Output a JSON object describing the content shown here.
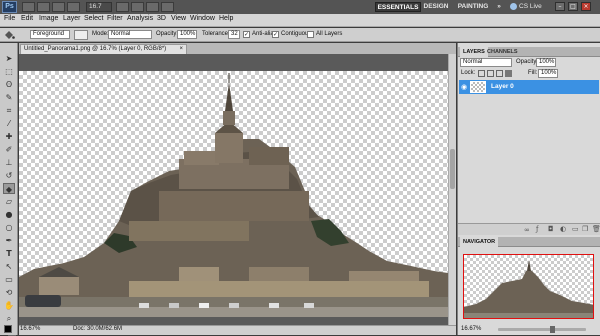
{
  "app": {
    "logo": "Ps",
    "zoom": "16.7"
  },
  "workspaces": {
    "essentials": "ESSENTIALS",
    "design": "DESIGN",
    "painting": "PAINTING",
    "more": "»",
    "cslive": "CS Live"
  },
  "menu": [
    "File",
    "Edit",
    "Image",
    "Layer",
    "Select",
    "Filter",
    "Analysis",
    "3D",
    "View",
    "Window",
    "Help"
  ],
  "options": {
    "fill_source": "Foreground",
    "mode_label": "Mode:",
    "mode_value": "Normal",
    "opacity_label": "Opacity:",
    "opacity_value": "100%",
    "tolerance_label": "Tolerance:",
    "tolerance_value": "32",
    "antialias_label": "Anti-alias",
    "contiguous_label": "Contiguous",
    "all_layers_label": "All Layers"
  },
  "document": {
    "tab_title": "Untitled_Panorama1.png @ 16.7% (Layer 0, RGB/8*)",
    "close_glyph": "×",
    "status_zoom": "16.67%",
    "status_doc": "Doc: 30.0M/62.6M"
  },
  "layers_panel": {
    "tab_layers": "LAYERS",
    "tab_channels": "CHANNELS",
    "blend_mode": "Normal",
    "opacity_label": "Opacity:",
    "opacity_value": "100%",
    "lock_label": "Lock:",
    "fill_label": "Fill:",
    "fill_value": "100%",
    "layer_name": "Layer 0"
  },
  "navigator_panel": {
    "tab": "NAVIGATOR",
    "zoom": "16.67%"
  },
  "colors": {
    "selection_blue": "#3b91e3",
    "nav_frame": "#e01010"
  }
}
